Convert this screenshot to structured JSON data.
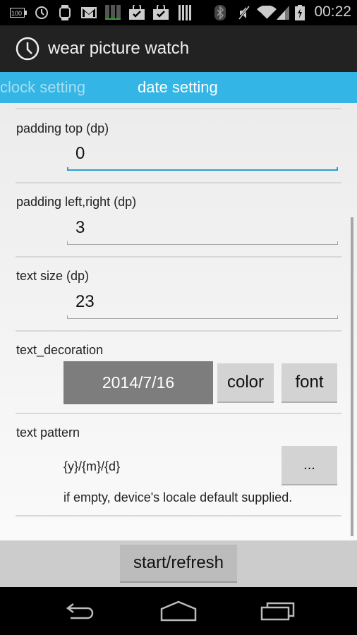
{
  "status_bar": {
    "time": "00:22",
    "battery_notification_text": "100",
    "icons": [
      "battery-100-notification-icon",
      "clock-icon",
      "watch-icon",
      "gmail-icon",
      "bars-green-icon",
      "store-check-icon",
      "store-check-icon",
      "barcode-icon",
      "bluetooth-icon",
      "mute-icon",
      "wifi-icon",
      "signal-icon",
      "battery-charging-icon"
    ]
  },
  "action_bar": {
    "icon": "clock-icon",
    "title": "wear picture watch"
  },
  "tabs": [
    {
      "label": "clock setting",
      "active": false
    },
    {
      "label": "date setting",
      "active": true
    }
  ],
  "settings": {
    "padding_top": {
      "label": "padding top (dp)",
      "value": "0"
    },
    "padding_lr": {
      "label": "padding left,right (dp)",
      "value": "3"
    },
    "text_size": {
      "label": "text size (dp)",
      "value": "23"
    },
    "text_decoration": {
      "label": "text_decoration",
      "preview": "2014/7/16",
      "color_button": "color",
      "font_button": "font"
    },
    "text_pattern": {
      "label": "text pattern",
      "value": "{y}/{m}/{d}",
      "more_button": "...",
      "hint": "if empty, device's locale default supplied."
    }
  },
  "bottom": {
    "start_button": "start/refresh"
  },
  "colors": {
    "accent": "#33b5e5",
    "focus_line": "#2d9fcf",
    "action_bar": "#222222"
  }
}
